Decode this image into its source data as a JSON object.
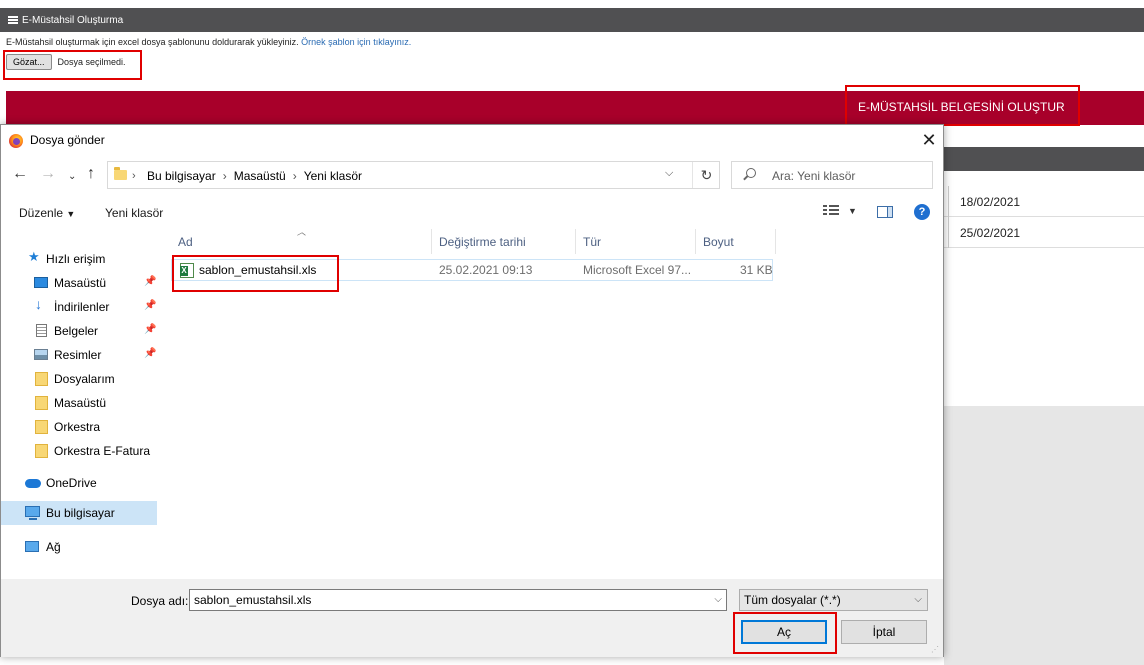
{
  "page": {
    "header_title": "E-Müstahsil Oluşturma",
    "instruction": "E-Müstahsil oluşturmak için excel dosya şablonunu doldurarak yükleyiniz.",
    "template_link": "Örnek şablon için tıklayınız.",
    "browse_label": "Gözat...",
    "browse_status": "Dosya seçilmedi.",
    "create_button": "E-MÜSTAHSİL BELGESİNİ OLUŞTUR",
    "dates": [
      "18/02/2021",
      "25/02/2021"
    ]
  },
  "dialog": {
    "title": "Dosya gönder",
    "breadcrumb": [
      "Bu bilgisayar",
      "Masaüstü",
      "Yeni klasör"
    ],
    "search_placeholder": "Ara: Yeni klasör",
    "toolbar": {
      "organize": "Düzenle",
      "new_folder": "Yeni klasör"
    },
    "sidebar": [
      {
        "label": "Hızlı erişim",
        "icon": "star-icon"
      },
      {
        "label": "Masaüstü",
        "icon": "desktop-icon",
        "pinned": true
      },
      {
        "label": "İndirilenler",
        "icon": "download-icon",
        "pinned": true
      },
      {
        "label": "Belgeler",
        "icon": "document-icon",
        "pinned": true
      },
      {
        "label": "Resimler",
        "icon": "pictures-icon",
        "pinned": true
      },
      {
        "label": "Dosyalarım",
        "icon": "folder-icon"
      },
      {
        "label": "Masaüstü",
        "icon": "folder-icon"
      },
      {
        "label": "Orkestra",
        "icon": "folder-icon"
      },
      {
        "label": "Orkestra E-Fatura",
        "icon": "folder-icon"
      },
      {
        "label": "OneDrive",
        "icon": "cloud-icon"
      },
      {
        "label": "Bu bilgisayar",
        "icon": "computer-icon",
        "selected": true
      },
      {
        "label": "Ağ",
        "icon": "network-icon"
      }
    ],
    "columns": [
      "Ad",
      "Değiştirme tarihi",
      "Tür",
      "Boyut"
    ],
    "files": [
      {
        "name": "sablon_emustahsil.xls",
        "modified": "25.02.2021 09:13",
        "type": "Microsoft Excel 97...",
        "size": "31 KB"
      }
    ],
    "filename_label": "Dosya adı:",
    "filename_value": "sablon_emustahsil.xls",
    "filetype": "Tüm dosyalar (*.*)",
    "open_button": "Aç",
    "cancel_button": "İptal"
  },
  "colors": {
    "accent_red": "#a8002a",
    "highlight_box": "#e00000",
    "header_gray": "#505052",
    "selection_blue": "#cce4f7"
  }
}
